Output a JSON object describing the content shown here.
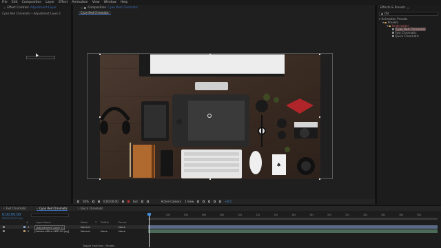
{
  "menu": [
    "File",
    "Edit",
    "Composition",
    "Layer",
    "Effect",
    "Animation",
    "View",
    "Window",
    "Help"
  ],
  "effect_controls": {
    "tab_prefix": "Effect Controls",
    "tab_layer": "Adjustment Layer",
    "breadcrumb": "Cyan Red Chromatic • Adjustment Layer 2"
  },
  "composition": {
    "tab_prefix": "Composition",
    "tab_name": "Cyan Red Chromatic",
    "tab_chip": "Cyan Red Chromatic",
    "zoom": "50%",
    "timecode": "0;00;00;00",
    "resolution": "Full",
    "camera": "Active Camera",
    "view": "1 View",
    "offset": "+0.0"
  },
  "effects_presets": {
    "title": "Effects & Presets",
    "search": "chr",
    "tree": [
      "Animation Presets",
      "Presets",
      "Underwater",
      "Cyan Red Chromatic",
      "Fast Chromatic",
      "Quick Chromatic"
    ]
  },
  "timeline": {
    "tabs": [
      "Fast Chromatic",
      "Cyan Red Chromatic",
      "Quick Chromatic"
    ],
    "timecode": "0;00;00;00",
    "fps_info": "00000 (29.97 fps)",
    "col_headers": [
      "#",
      "Layer Name",
      "Mode",
      "T",
      "TrkMat",
      "Parent"
    ],
    "layers": [
      {
        "num": "1",
        "name": "[Adjustment Layer 2]",
        "mode": "Normal",
        "trkmat": "",
        "parent": "None"
      },
      {
        "num": "2",
        "name": "[hobies-office-465140.jpg]",
        "mode": "Normal",
        "trkmat": "None",
        "parent": "None"
      }
    ],
    "ticks": [
      "0s",
      "02s",
      "04s",
      "06s",
      "08s",
      "10s",
      "12s",
      "14s",
      "16s",
      "18s",
      "20s",
      "22s",
      "24s",
      "26s",
      "28s",
      "30s"
    ],
    "footer": "Toggle Switches / Modes"
  }
}
